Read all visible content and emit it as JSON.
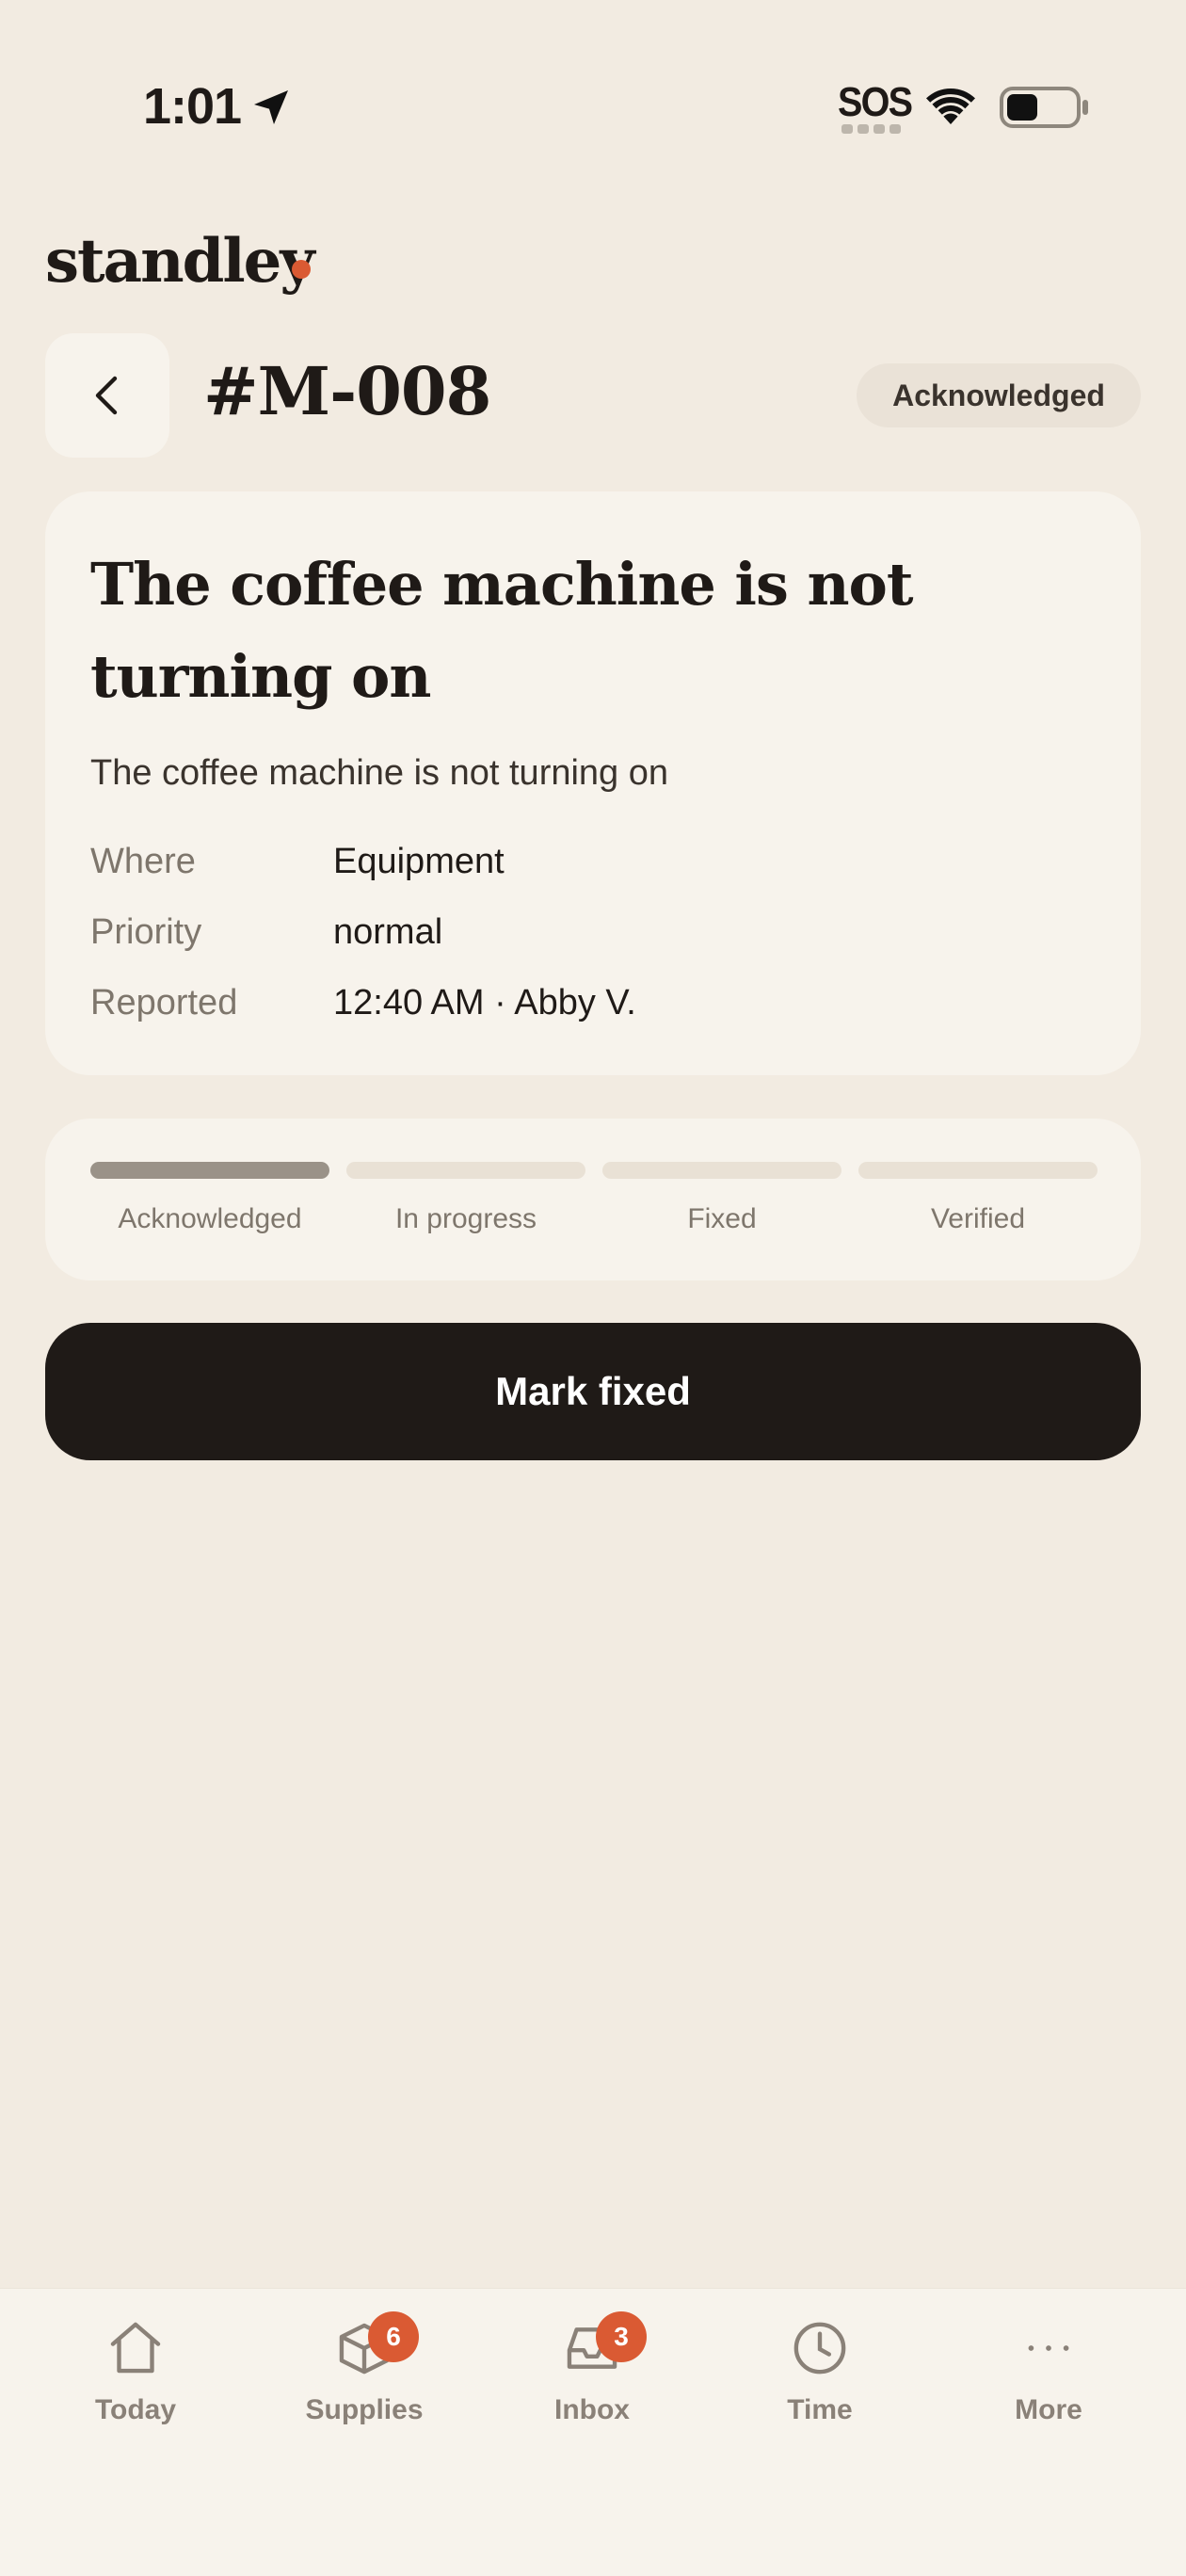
{
  "status_bar": {
    "time": "1:01",
    "sos": "SOS"
  },
  "brand": {
    "name": "standley",
    "accent_color": "#DA5A33"
  },
  "header": {
    "ticket_id": "#M-008",
    "status": "Acknowledged"
  },
  "issue": {
    "title": "The coffee machine is not turning on",
    "description": "The coffee machine is not turning on",
    "meta": [
      {
        "label": "Where",
        "value": "Equipment"
      },
      {
        "label": "Priority",
        "value": "normal"
      },
      {
        "label": "Reported",
        "value": "12:40 AM · Abby V."
      }
    ]
  },
  "progress": {
    "current_step": 1,
    "steps": [
      {
        "label": "Acknowledged",
        "active": true
      },
      {
        "label": "In progress",
        "active": false
      },
      {
        "label": "Fixed",
        "active": false
      },
      {
        "label": "Verified",
        "active": false
      }
    ]
  },
  "primary_action": {
    "label": "Mark fixed"
  },
  "tab_bar": {
    "items": [
      {
        "label": "Today",
        "icon": "home-icon",
        "badge": null
      },
      {
        "label": "Supplies",
        "icon": "box-icon",
        "badge": "6"
      },
      {
        "label": "Inbox",
        "icon": "inbox-icon",
        "badge": "3"
      },
      {
        "label": "Time",
        "icon": "clock-icon",
        "badge": null
      },
      {
        "label": "More",
        "icon": "more-icon",
        "badge": null
      }
    ]
  }
}
